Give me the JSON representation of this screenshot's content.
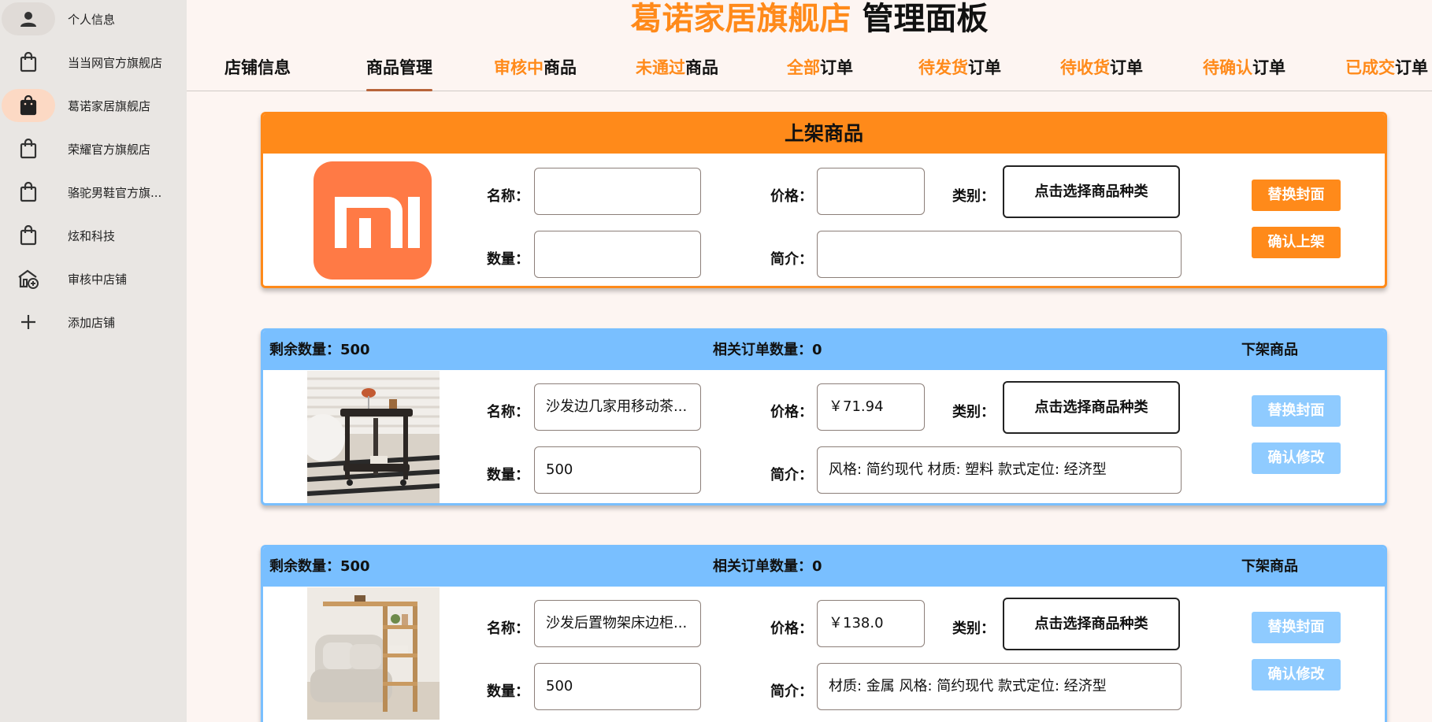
{
  "sidebar": {
    "items": [
      {
        "label": "个人信息",
        "icon": "person-icon"
      },
      {
        "label": "当当网官方旗舰店",
        "icon": "shopping-bag-icon"
      },
      {
        "label": "葛诺家居旗舰店",
        "icon": "shopping-bag-icon"
      },
      {
        "label": "荣耀官方旗舰店",
        "icon": "shopping-bag-icon"
      },
      {
        "label": "骆驼男鞋官方旗...",
        "icon": "shopping-bag-icon"
      },
      {
        "label": "炫和科技",
        "icon": "shopping-bag-icon"
      },
      {
        "label": "审核中店铺",
        "icon": "store-add-icon"
      },
      {
        "label": "添加店铺",
        "icon": "plus-icon"
      }
    ]
  },
  "header": {
    "brand": "葛诺家居旗舰店",
    "title_suffix": "管理面板"
  },
  "tabs": [
    {
      "hl": "",
      "text": "店铺信息"
    },
    {
      "hl": "",
      "text": "商品管理"
    },
    {
      "hl": "审核中",
      "text": "商品"
    },
    {
      "hl": "未通过",
      "text": "商品"
    },
    {
      "hl": "全部",
      "text": "订单"
    },
    {
      "hl": "待发货",
      "text": "订单"
    },
    {
      "hl": "待收货",
      "text": "订单"
    },
    {
      "hl": "待确认",
      "text": "订单"
    },
    {
      "hl": "已成交",
      "text": "订单"
    }
  ],
  "add_card": {
    "title": "上架商品",
    "name_label": "名称：",
    "price_label": "价格：",
    "category_label": "类别：",
    "category_button": "点击选择商品种类",
    "quantity_label": "数量：",
    "desc_label": "简介：",
    "replace_cover": "替换封面",
    "confirm_listing": "确认上架",
    "name_value": "",
    "price_value": "",
    "quantity_value": "",
    "desc_value": "",
    "logo_text": "mi"
  },
  "products": [
    {
      "remaining": "剩余数量：500",
      "orders": "相关订单数量：0",
      "delist": "下架商品",
      "name_label": "名称：",
      "name": "沙发边几家用移动茶...",
      "price_label": "价格：",
      "price": "￥71.94",
      "category_label": "类别：",
      "category_button": "点击选择商品种类",
      "quantity_label": "数量：",
      "quantity": "500",
      "desc_label": "简介：",
      "desc": "风格: 简约现代 材质: 塑料 款式定位: 经济型",
      "replace_cover": "替换封面",
      "confirm_edit": "确认修改"
    },
    {
      "remaining": "剩余数量：500",
      "orders": "相关订单数量：0",
      "delist": "下架商品",
      "name_label": "名称：",
      "name": "沙发后置物架床边柜...",
      "price_label": "价格：",
      "price": "￥138.0",
      "category_label": "类别：",
      "category_button": "点击选择商品种类",
      "quantity_label": "数量：",
      "quantity": "500",
      "desc_label": "简介：",
      "desc": "材质: 金属 风格: 简约现代 款式定位: 经济型",
      "replace_cover": "替换封面",
      "confirm_edit": "确认修改"
    }
  ],
  "colors": {
    "accent": "#ff8a1a",
    "card_blue": "#79bfff",
    "button_blue": "#8fcbff",
    "sidebar_bg": "#e9e6e3",
    "active_pill": "#fcd9c4",
    "page_bg": "#fdf5f2"
  }
}
